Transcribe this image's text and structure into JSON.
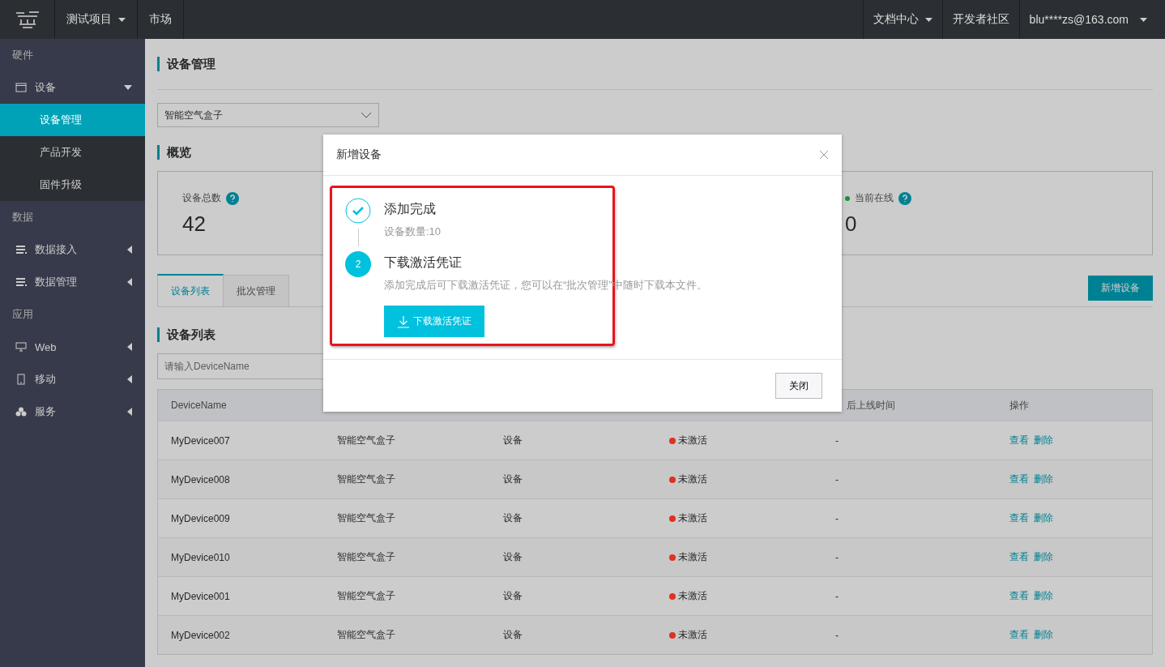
{
  "topbar": {
    "nav_left": [
      {
        "label": "测试项目",
        "dropdown": true
      },
      {
        "label": "市场",
        "dropdown": false
      }
    ],
    "nav_right": [
      {
        "label": "文档中心",
        "dropdown": true
      },
      {
        "label": "开发者社区",
        "dropdown": false
      },
      {
        "label": "blu****zs@163.com",
        "dropdown": true
      }
    ]
  },
  "sidebar": {
    "sections": [
      {
        "title": "硬件",
        "items": [
          {
            "label": "设备",
            "expanded": true,
            "children": [
              {
                "label": "设备管理",
                "selected": true
              },
              {
                "label": "产品开发",
                "selected": false
              },
              {
                "label": "固件升级",
                "selected": false
              }
            ]
          }
        ]
      },
      {
        "title": "数据",
        "items": [
          {
            "label": "数据接入",
            "expanded": false
          },
          {
            "label": "数据管理",
            "expanded": false
          }
        ]
      },
      {
        "title": "应用",
        "items": [
          {
            "label": "Web",
            "expanded": false
          },
          {
            "label": "移动",
            "expanded": false
          },
          {
            "label": "服务",
            "expanded": false
          }
        ]
      }
    ]
  },
  "page_title": "设备管理",
  "product_select": {
    "value": "智能空气盒子"
  },
  "overview": {
    "title": "概览",
    "stats": [
      {
        "label": "设备总数",
        "value": "42",
        "dot": false
      },
      {
        "label": "当前在线",
        "value": "0",
        "dot": true,
        "color": "#169040"
      }
    ]
  },
  "tabs": [
    {
      "label": "设备列表",
      "selected": true
    },
    {
      "label": "批次管理",
      "selected": false
    }
  ],
  "add_button": "新增设备",
  "list_title": "设备列表",
  "search": {
    "placeholder": "请输入DeviceName"
  },
  "table": {
    "columns": [
      "DeviceName",
      "后上线时间",
      "操作"
    ],
    "rows": [
      {
        "name": "MyDevice007",
        "product": "智能空气盒子",
        "type": "设备",
        "status": "未激活",
        "color": "#e0301e",
        "last_online": "-",
        "actions": [
          "查看",
          "删除"
        ]
      },
      {
        "name": "MyDevice008",
        "product": "智能空气盒子",
        "type": "设备",
        "status": "未激活",
        "color": "#e0301e",
        "last_online": "-",
        "actions": [
          "查看",
          "删除"
        ]
      },
      {
        "name": "MyDevice009",
        "product": "智能空气盒子",
        "type": "设备",
        "status": "未激活",
        "color": "#e0301e",
        "last_online": "-",
        "actions": [
          "查看",
          "删除"
        ]
      },
      {
        "name": "MyDevice010",
        "product": "智能空气盒子",
        "type": "设备",
        "status": "未激活",
        "color": "#e0301e",
        "last_online": "-",
        "actions": [
          "查看",
          "删除"
        ]
      },
      {
        "name": "MyDevice001",
        "product": "智能空气盒子",
        "type": "设备",
        "status": "未激活",
        "color": "#e0301e",
        "last_online": "-",
        "actions": [
          "查看",
          "删除"
        ]
      },
      {
        "name": "MyDevice002",
        "product": "智能空气盒子",
        "type": "设备",
        "status": "未激活",
        "color": "#e0301e",
        "last_online": "-",
        "actions": [
          "查看",
          "删除"
        ]
      }
    ]
  },
  "modal": {
    "title": "新增设备",
    "steps": [
      {
        "kind": "done",
        "title": "添加完成",
        "detail": "设备数量:10"
      },
      {
        "kind": "current",
        "number": "2",
        "title": "下载激活凭证",
        "detail": "添加完成后可下载激活凭证，您可以在“批次管理”中随时下载本文件。",
        "button": "下载激活凭证"
      }
    ],
    "close_button": "关闭"
  }
}
